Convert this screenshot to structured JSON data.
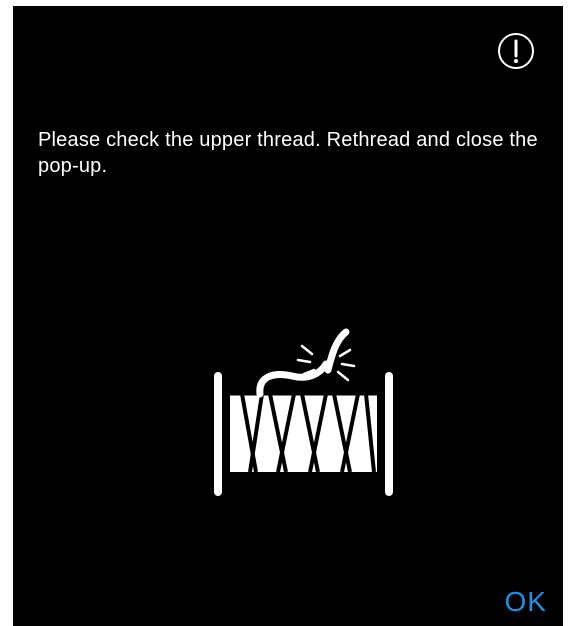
{
  "dialog": {
    "icon": "exclamation-circle-icon",
    "message": "Please check the upper thread. Rethread and close the pop-up.",
    "illustration": "broken-thread-spool-icon",
    "ok_label": "OK"
  },
  "colors": {
    "background": "#000000",
    "text": "#ffffff",
    "accent": "#1f8fe0"
  }
}
